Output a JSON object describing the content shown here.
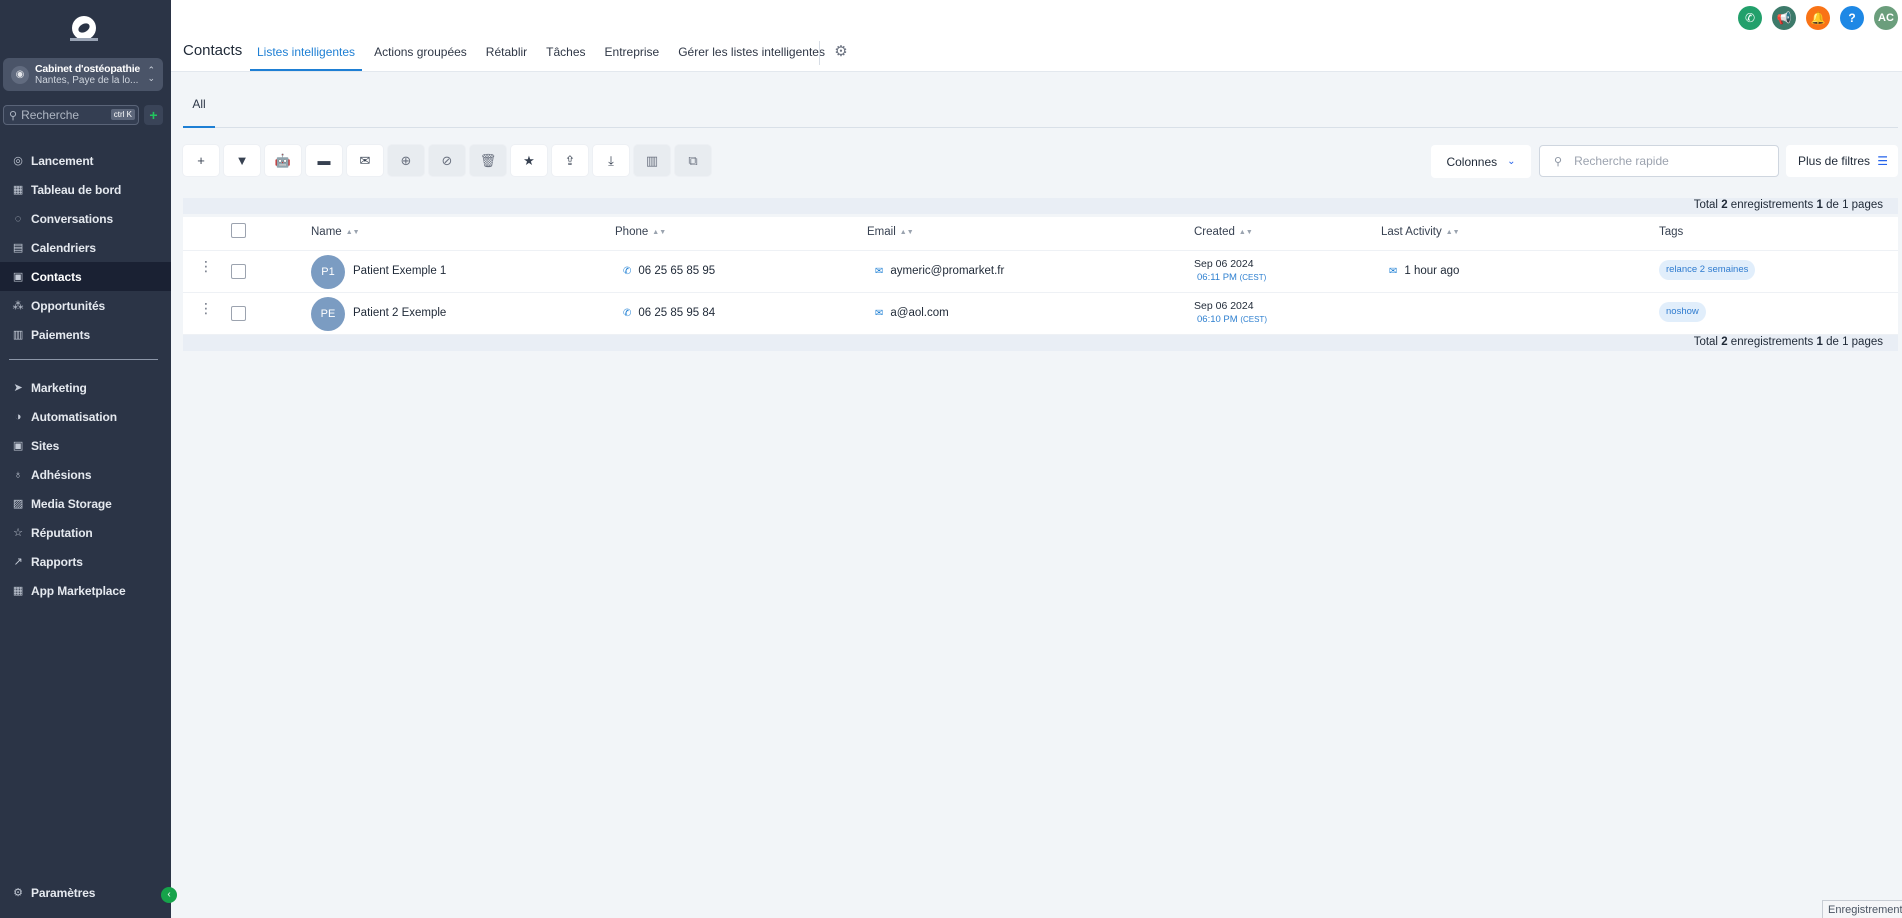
{
  "sidebar": {
    "account": {
      "name": "Cabinet d'ostéopathie",
      "location": "Nantes, Paye de la lo..."
    },
    "search": {
      "placeholder": "Recherche",
      "shortcut": "ctrl K"
    },
    "nav_main": [
      {
        "label": "Lancement",
        "icon": "rocket-icon",
        "glyph": "◎"
      },
      {
        "label": "Tableau de bord",
        "icon": "dashboard-icon",
        "glyph": "▦"
      },
      {
        "label": "Conversations",
        "icon": "chat-icon",
        "glyph": "◌"
      },
      {
        "label": "Calendriers",
        "icon": "calendar-icon",
        "glyph": "▤"
      },
      {
        "label": "Contacts",
        "icon": "contacts-icon",
        "glyph": "▣"
      },
      {
        "label": "Opportunités",
        "icon": "opportunities-icon",
        "glyph": "⁂"
      },
      {
        "label": "Paiements",
        "icon": "payments-icon",
        "glyph": "▥"
      }
    ],
    "nav_secondary": [
      {
        "label": "Marketing",
        "icon": "send-icon",
        "glyph": "➤"
      },
      {
        "label": "Automatisation",
        "icon": "automation-icon",
        "glyph": "◑"
      },
      {
        "label": "Sites",
        "icon": "sites-icon",
        "glyph": "▣"
      },
      {
        "label": "Adhésions",
        "icon": "membership-icon",
        "glyph": "♁"
      },
      {
        "label": "Media Storage",
        "icon": "media-icon",
        "glyph": "▨"
      },
      {
        "label": "Réputation",
        "icon": "star-icon",
        "glyph": "☆"
      },
      {
        "label": "Rapports",
        "icon": "chart-icon",
        "glyph": "↗"
      },
      {
        "label": "App Marketplace",
        "icon": "apps-icon",
        "glyph": "▦"
      }
    ],
    "settings": {
      "label": "Paramètres",
      "glyph": "⚙"
    }
  },
  "header": {
    "title": "Contacts",
    "tabs": [
      "Listes intelligentes",
      "Actions groupées",
      "Rétablir",
      "Tâches",
      "Entreprise",
      "Gérer les listes intelligentes"
    ],
    "avatar_initials": "AC",
    "icons": [
      {
        "name": "phone-icon",
        "glyph": "✆",
        "color": "#22a06b"
      },
      {
        "name": "megaphone-icon",
        "glyph": "📢",
        "color": "#3d7a6a"
      },
      {
        "name": "bell-icon",
        "glyph": "🔔",
        "color": "#f97316"
      },
      {
        "name": "help-icon",
        "glyph": "?",
        "color": "#1e88e5"
      }
    ]
  },
  "subtabs": {
    "all": "All"
  },
  "toolbar": {
    "buttons": [
      {
        "name": "add-contact-button",
        "glyph": "+",
        "muted": false
      },
      {
        "name": "filter-button",
        "glyph": "▼",
        "muted": false
      },
      {
        "name": "workflow-button",
        "glyph": "🤖",
        "muted": false
      },
      {
        "name": "sms-button",
        "glyph": "▬",
        "muted": false
      },
      {
        "name": "email-button",
        "glyph": "✉",
        "muted": false
      },
      {
        "name": "add-tag-button",
        "glyph": "⊕",
        "muted": true
      },
      {
        "name": "remove-tag-button",
        "glyph": "⊘",
        "muted": true
      },
      {
        "name": "delete-button",
        "glyph": "🗑",
        "muted": true
      },
      {
        "name": "star-button",
        "glyph": "★",
        "muted": false
      },
      {
        "name": "export-button",
        "glyph": "⇪",
        "muted": false
      },
      {
        "name": "import-button",
        "glyph": "⤓",
        "muted": false
      },
      {
        "name": "company-button",
        "glyph": "▥",
        "muted": true
      },
      {
        "name": "merge-button",
        "glyph": "⧉",
        "muted": true
      }
    ],
    "columns_label": "Colonnes",
    "quick_search_placeholder": "Recherche rapide",
    "more_filters_label": "Plus de filtres"
  },
  "pagination": {
    "prefix": "Total",
    "count": "2",
    "middle": "enregistrements",
    "page": "1",
    "suffix": "de 1 pages"
  },
  "table": {
    "columns": {
      "name": "Name",
      "phone": "Phone",
      "email": "Email",
      "created": "Created",
      "last_activity": "Last Activity",
      "tags": "Tags"
    },
    "rows": [
      {
        "initials": "P1",
        "name": "Patient Exemple 1",
        "phone": "06 25 65 85 95",
        "email": "aymeric@promarket.fr",
        "created_date": "Sep 06 2024",
        "created_time": "06:11 PM",
        "tz": "(CEST)",
        "last_activity": "1 hour ago",
        "tag": "relance 2 semaines"
      },
      {
        "initials": "PE",
        "name": "Patient 2 Exemple",
        "phone": "06 25 85 95 84",
        "email": "a@aol.com",
        "created_date": "Sep 06 2024",
        "created_time": "06:10 PM",
        "tz": "(CEST)",
        "last_activity": "",
        "tag": "noshow"
      }
    ]
  },
  "footer": {
    "save_label": "Enregistrement"
  }
}
